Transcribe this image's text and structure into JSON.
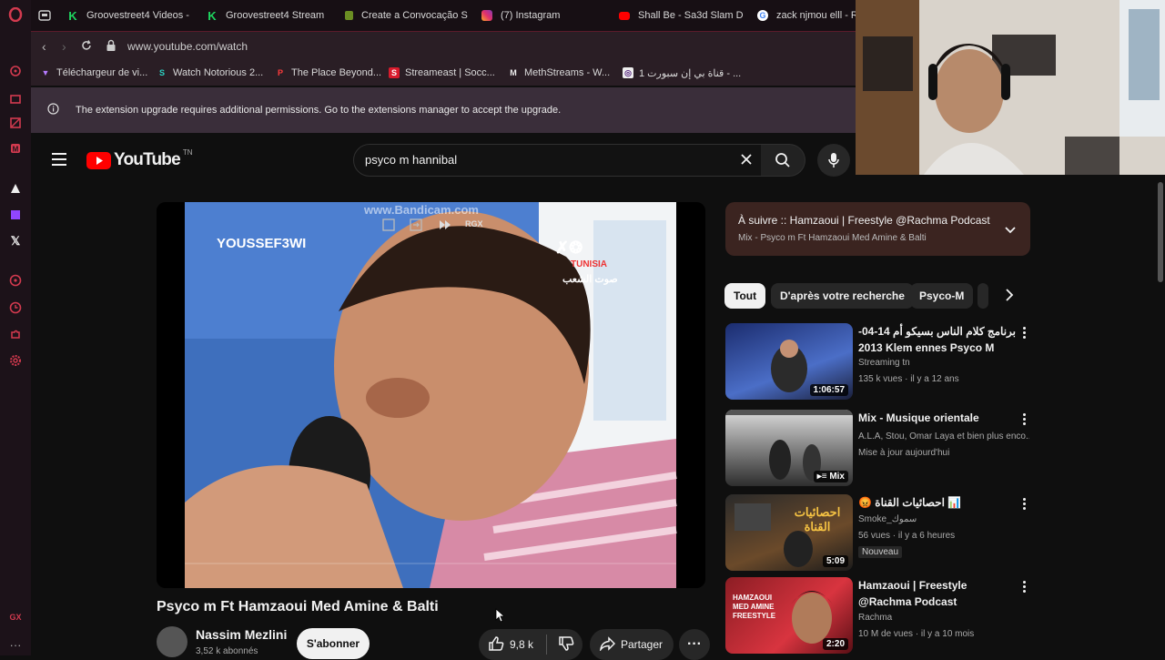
{
  "browser": {
    "tabs": [
      {
        "label": "Groovestreet4 Videos -",
        "icon": "k-green-icon"
      },
      {
        "label": "Groovestreet4 Stream",
        "icon": "k-green-icon"
      },
      {
        "label": "Create a Convocação S",
        "icon": "doc-icon"
      },
      {
        "label": "(7) Instagram",
        "icon": "instagram-icon"
      },
      {
        "label": "Shall Be - Sa3d Slam D",
        "icon": "youtube-icon"
      },
      {
        "label": "zack njmou elll - R",
        "icon": "google-icon"
      }
    ],
    "url": "www.youtube.com/watch",
    "bookmarks": [
      "Téléchargeur de vi...",
      "Watch Notorious 2...",
      "The Place Beyond...",
      "Streameast | Socc...",
      "MethStreams - W...",
      "قناة بي إن سبورت 1 - ..."
    ],
    "notice": "The extension upgrade requires additional permissions. Go to the extensions manager to accept the upgrade."
  },
  "youtube": {
    "logo_text": "YouTube",
    "logo_region": "TN",
    "search_value": "psyco m hannibal",
    "video": {
      "overlay_watermark": "www.Bandicam.com",
      "overlay_name": "YOUSSEF3WI",
      "overlay_logo": "TUNISIA",
      "overlay_logo_sub": "صوت الشعب",
      "overlay_rgx": "RGX",
      "title": "Psyco m Ft Hamzaoui Med Amine & Balti",
      "channel": "Nassim Mezlini",
      "subscribers": "3,52 k abonnés",
      "subscribe_label": "S'abonner",
      "likes": "9,8 k",
      "share_label": "Partager"
    },
    "playlist": {
      "title": "À suivre :: Hamzaoui | Freestyle @Rachma Podcast",
      "subtitle": "Mix - Psyco m Ft Hamzaoui Med Amine & Balti"
    },
    "chips": [
      "Tout",
      "D'après votre recherche",
      "Psyco-M"
    ],
    "videos": [
      {
        "title": "برنامج كلام الناس  بسيكو أم 14-04-2013 Klem ennes Psyco M",
        "channel": "Streaming tn",
        "meta": "135 k vues · il y a 12 ans",
        "duration": "1:06:57"
      },
      {
        "title": "Mix - Musique orientale",
        "channel": "A.L.A, Stou, Omar Laya et bien plus enco...",
        "meta": "Mise à jour aujourd'hui",
        "duration": "Mix"
      },
      {
        "title": "😡 احصائيات القناة 📊",
        "channel": "Smoke_سموك",
        "meta": "56 vues · il y a 6 heures",
        "badge": "Nouveau",
        "duration": "5:09",
        "thumb_text": "احصائيات القناة"
      },
      {
        "title": "Hamzaoui | Freestyle @Rachma Podcast",
        "channel": "Rachma",
        "meta": "10 M de vues · il y a 10 mois",
        "duration": "2:20",
        "thumb_text": "HAMZAOUI MED AMINE FREESTYLE"
      }
    ]
  },
  "colors": {
    "opera_red": "#d33a4f",
    "youtube_red": "#ff0000",
    "bg": "#0f0f0f"
  }
}
